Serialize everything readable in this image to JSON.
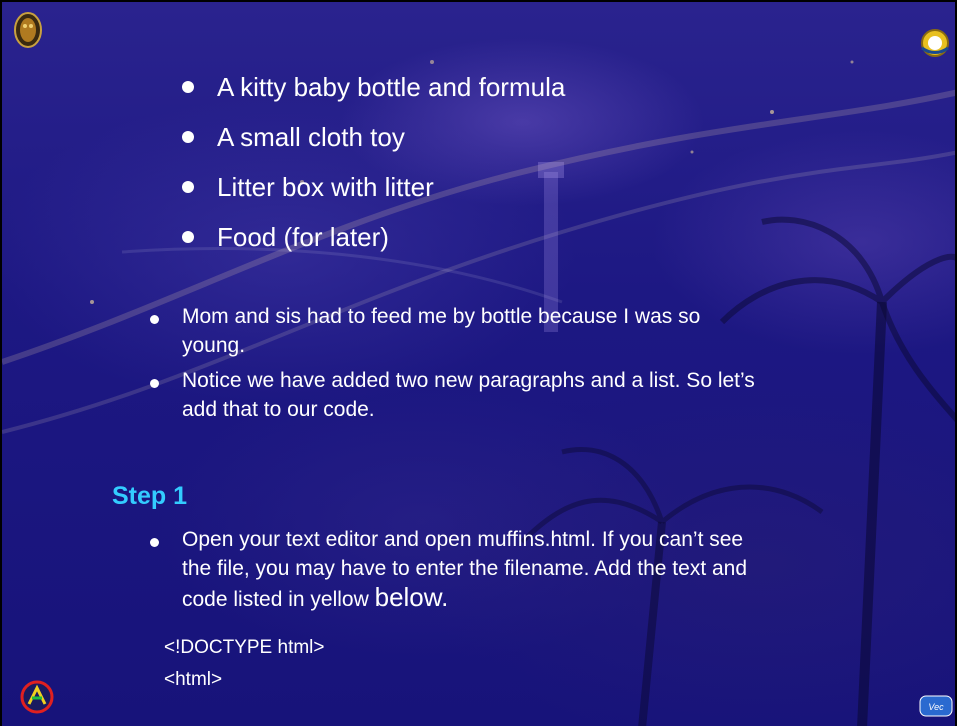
{
  "slide": {
    "kitten_list": [
      "A kitty baby bottle and formula",
      "A small cloth toy",
      "Litter box with litter",
      "Food (for later)"
    ],
    "paragraphs": [
      {
        "line1": "Mom and sis had to feed me by bottle because I was so",
        "line2": "young."
      },
      {
        "line1": "Notice we have added two new paragraphs and a list. So let’s",
        "line2": "add that to our code."
      }
    ],
    "step": {
      "heading": "Step 1",
      "instruction_line1": "Open your text editor and open muffins.html. If you can’t see",
      "instruction_line2": "the file, you may have to enter the filename. Add the text and",
      "instruction_line3_start": "code listed in yellow ",
      "instruction_line3_emph": "below."
    },
    "code_lines": [
      "<!DOCTYPE html>",
      "<html>"
    ],
    "logos": {
      "top_left": "owl-emblem-icon",
      "top_right": "university-seal-icon",
      "bottom_left": "circular-emblem-icon",
      "bottom_right": "vector-logo-icon"
    },
    "colors": {
      "background": "#1d1883",
      "text": "#ffffff",
      "step_heading": "#33ccff"
    }
  }
}
